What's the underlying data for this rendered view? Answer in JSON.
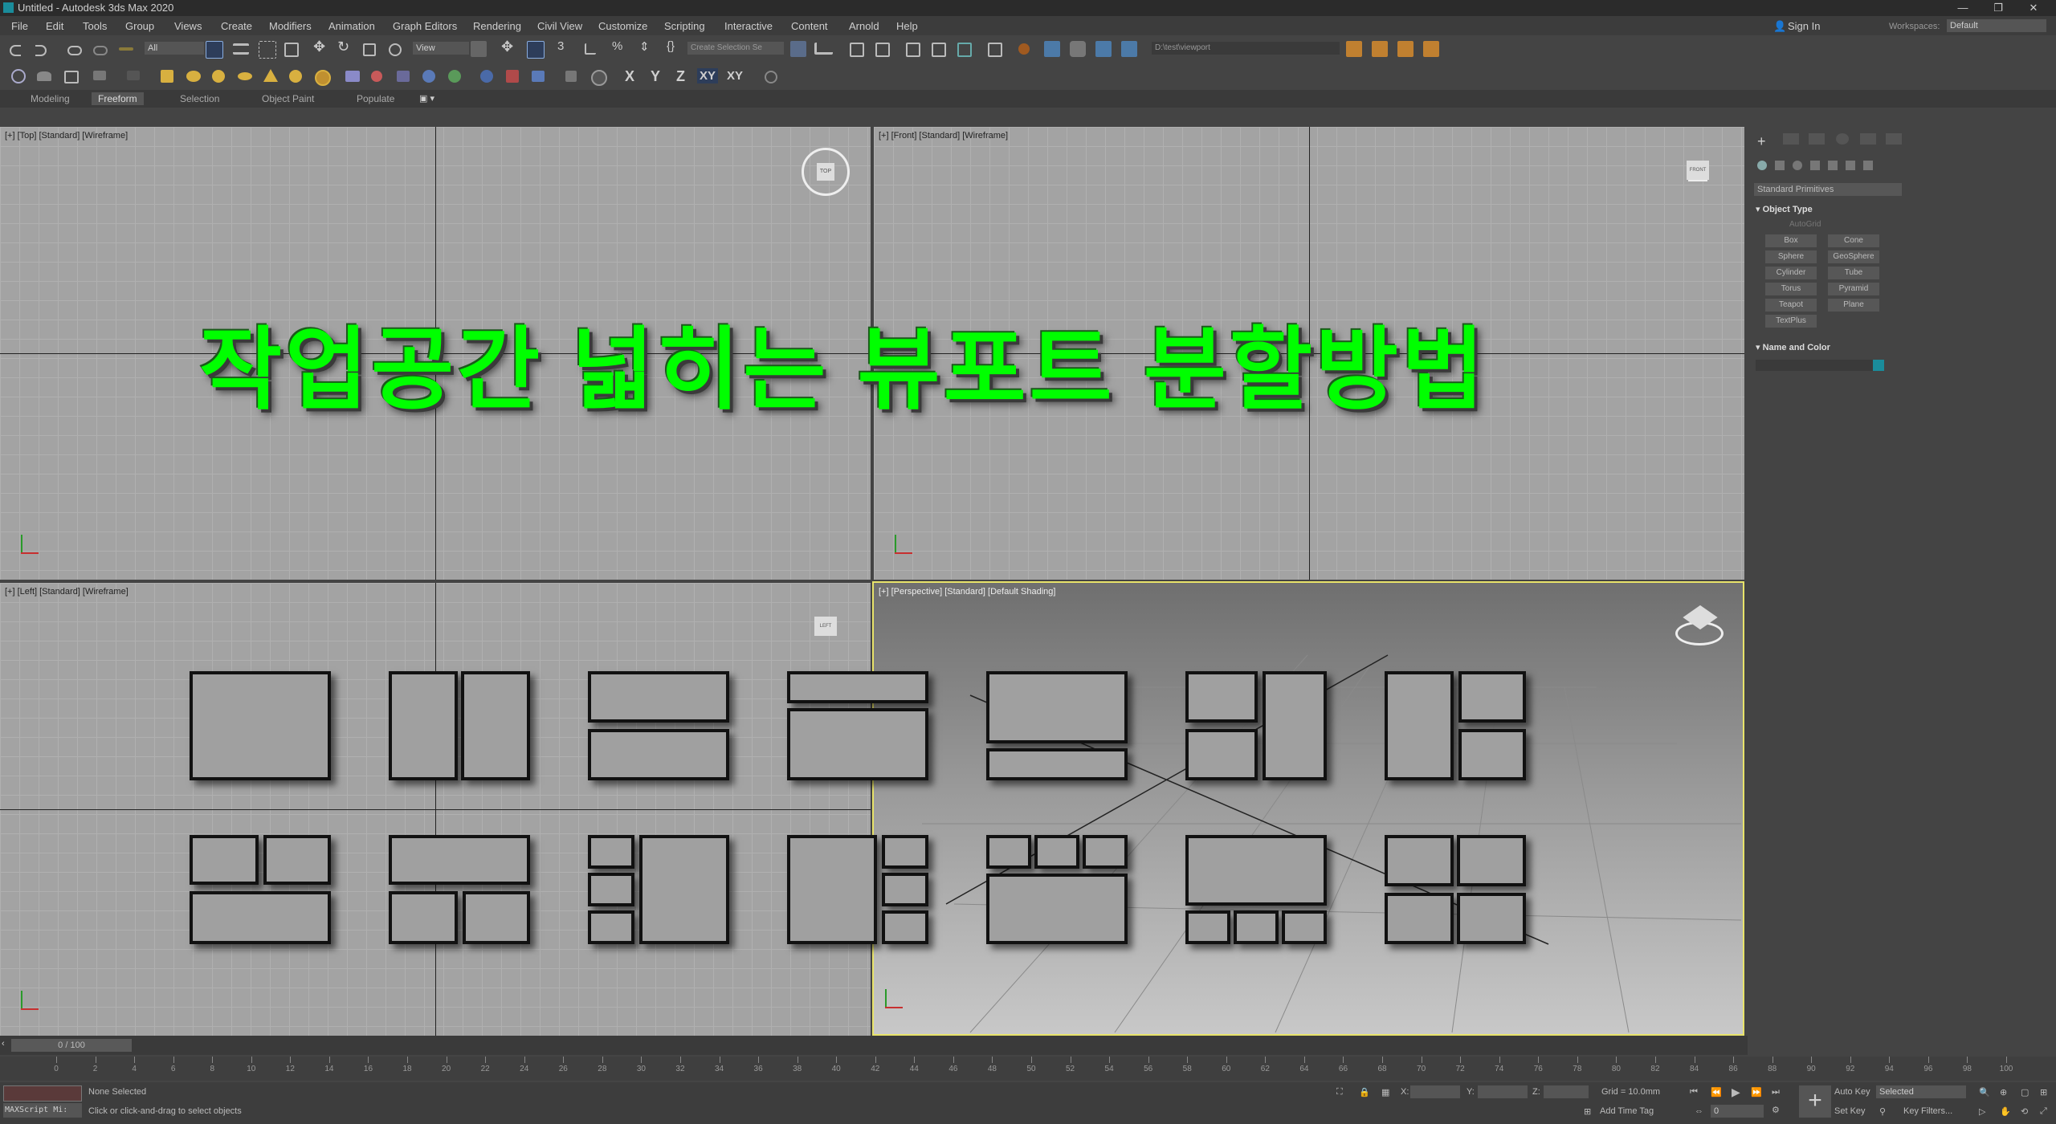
{
  "window": {
    "title": "Untitled - Autodesk 3ds Max 2020",
    "controls": [
      "—",
      "❐",
      "✕"
    ]
  },
  "menu": [
    "File",
    "Edit",
    "Tools",
    "Group",
    "Views",
    "Create",
    "Modifiers",
    "Animation",
    "Graph Editors",
    "Rendering",
    "Civil View",
    "Customize",
    "Scripting",
    "Interactive",
    "Content",
    "Arnold",
    "Help"
  ],
  "account": {
    "signin": "Sign In",
    "workspaces_label": "Workspaces:",
    "workspace": "Default"
  },
  "toolbar": {
    "filter": "All",
    "view": "View",
    "selection_set": "Create Selection Se",
    "path": "D:\\test\\viewport",
    "axes": [
      "X",
      "Y",
      "Z",
      "XY",
      "XY"
    ]
  },
  "ribbon": {
    "tabs": [
      "Modeling",
      "Freeform",
      "Selection",
      "Object Paint",
      "Populate"
    ],
    "active": "Freeform"
  },
  "viewports": {
    "top": "[+] [Top] [Standard] [Wireframe]",
    "front": "[+] [Front] [Standard] [Wireframe]",
    "left": "[+] [Left] [Standard] [Wireframe]",
    "perspective": "[+] [Perspective] [Standard] [Default Shading]",
    "viewcube_top": "TOP",
    "viewcube_front": "FRONT",
    "viewcube_left": "LEFT"
  },
  "overlay": {
    "title": "작업공간 넓히는 뷰포트 분할방법"
  },
  "command_panel": {
    "dropdown": "Standard Primitives",
    "object_type": "Object Type",
    "autogrid": "AutoGrid",
    "buttons": [
      "Box",
      "Cone",
      "Sphere",
      "GeoSphere",
      "Cylinder",
      "Tube",
      "Torus",
      "Pyramid",
      "Teapot",
      "Plane",
      "TextPlus"
    ],
    "name_color": "Name and Color"
  },
  "timeline": {
    "frame": "0 / 100",
    "ticks": [
      "0",
      "2",
      "4",
      "6",
      "8",
      "10",
      "12",
      "14",
      "16",
      "18",
      "20",
      "22",
      "24",
      "26",
      "28",
      "30",
      "32",
      "34",
      "36",
      "38",
      "40",
      "42",
      "44",
      "46",
      "48",
      "50",
      "52",
      "54",
      "56",
      "58",
      "60",
      "62",
      "64",
      "66",
      "68",
      "70",
      "72",
      "74",
      "76",
      "78",
      "80",
      "82",
      "84",
      "86",
      "88",
      "90",
      "92",
      "94",
      "96",
      "98",
      "100"
    ]
  },
  "status": {
    "maxscript": "MAXScript Mi:",
    "selected": "None Selected",
    "hint": "Click or click-and-drag to select objects",
    "x_label": "X:",
    "y_label": "Y:",
    "z_label": "Z:",
    "grid": "Grid = 10.0mm",
    "add_time_tag": "Add Time Tag",
    "auto_key": "Auto Key",
    "set_key": "Set Key",
    "selected_dd": "Selected",
    "key_filters": "Key Filters...",
    "frame_field": "0"
  },
  "colors": {
    "overlay_green": "#00ff00",
    "active_viewport_border": "#e8e36a"
  }
}
